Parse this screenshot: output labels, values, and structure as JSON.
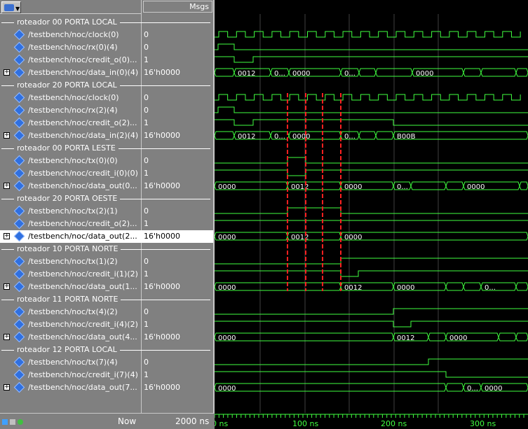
{
  "header": {
    "msgs_label": "Msgs"
  },
  "signals": [
    {
      "type": "divider",
      "label": "roteador 00 PORTA LOCAL"
    },
    {
      "type": "signal",
      "name": "/testbench/noc/clock(0)",
      "value": "0",
      "icon": "clock-signal-icon"
    },
    {
      "type": "signal",
      "name": "/testbench/noc/rx(0)(4)",
      "value": "0"
    },
    {
      "type": "signal",
      "name": "/testbench/noc/credit_o(0)...",
      "value": "1"
    },
    {
      "type": "bus",
      "name": "/testbench/noc/data_in(0)(4)",
      "value": "16'h0000"
    },
    {
      "type": "divider",
      "label": "roteador 20 PORTA LOCAL"
    },
    {
      "type": "signal",
      "name": "/testbench/noc/clock(0)",
      "value": "0",
      "icon": "clock-signal-icon"
    },
    {
      "type": "signal",
      "name": "/testbench/noc/rx(2)(4)",
      "value": "0"
    },
    {
      "type": "signal",
      "name": "/testbench/noc/credit_o(2)...",
      "value": "1"
    },
    {
      "type": "bus",
      "name": "/testbench/noc/data_in(2)(4)",
      "value": "16'h0000"
    },
    {
      "type": "divider",
      "label": "roteador 00 PORTA LESTE"
    },
    {
      "type": "signal",
      "name": "/testbench/noc/tx(0)(0)",
      "value": "0"
    },
    {
      "type": "signal",
      "name": "/testbench/noc/credit_i(0)(0)",
      "value": "1"
    },
    {
      "type": "bus",
      "name": "/testbench/noc/data_out(0...",
      "value": "16'h0000"
    },
    {
      "type": "divider",
      "label": "roteador 20 PORTA OESTE"
    },
    {
      "type": "signal",
      "name": "/testbench/noc/tx(2)(1)",
      "value": "0"
    },
    {
      "type": "signal",
      "name": "/testbench/noc/credit_o(2)...",
      "value": "1"
    },
    {
      "type": "bus",
      "name": "/testbench/noc/data_out(2...",
      "value": "16'h0000",
      "selected": true
    },
    {
      "type": "divider",
      "label": "roteador 10 PORTA NORTE"
    },
    {
      "type": "signal",
      "name": "/testbench/noc/tx(1)(2)",
      "value": "0"
    },
    {
      "type": "signal",
      "name": "/testbench/noc/credit_i(1)(2)",
      "value": "1"
    },
    {
      "type": "bus",
      "name": "/testbench/noc/data_out(1...",
      "value": "16'h0000"
    },
    {
      "type": "divider",
      "label": "roteador 11 PORTA NORTE"
    },
    {
      "type": "signal",
      "name": "/testbench/noc/tx(4)(2)",
      "value": "0"
    },
    {
      "type": "signal",
      "name": "/testbench/noc/credit_i(4)(2)",
      "value": "1"
    },
    {
      "type": "bus",
      "name": "/testbench/noc/data_out(4...",
      "value": "16'h0000"
    },
    {
      "type": "divider",
      "label": "roteador 12 PORTA LOCAL"
    },
    {
      "type": "signal",
      "name": "/testbench/noc/tx(7)(4)",
      "value": "0"
    },
    {
      "type": "signal",
      "name": "/testbench/noc/credit_i(7)(4)",
      "value": "1"
    },
    {
      "type": "bus",
      "name": "/testbench/noc/data_out(7...",
      "value": "16'h0000"
    }
  ],
  "bus_labels": {
    "data_in_0": [
      "0012",
      "0...",
      "0000",
      "0...",
      "0000"
    ],
    "data_in_2": [
      "0012",
      "0...",
      "0000",
      "0...",
      "B00B"
    ],
    "data_out_0": [
      "0000",
      "0012",
      "0000",
      "0...",
      "0000"
    ],
    "data_out_2": [
      "0000",
      "0012",
      "0000"
    ],
    "data_out_1": [
      "0000",
      "0012",
      "0000",
      "0..."
    ],
    "data_out_4": [
      "0000",
      "0012",
      "0000"
    ],
    "data_out_7": [
      "0000",
      "0...",
      "0000"
    ]
  },
  "status": {
    "now_label": "Now",
    "now_value": "2000 ns"
  },
  "timeline": {
    "ticks": [
      "0 ns",
      "100 ns",
      "200 ns",
      "300 ns"
    ]
  },
  "colors": {
    "wave": "#40ff40",
    "cursor": "#ff2020",
    "grid": "#404040"
  }
}
